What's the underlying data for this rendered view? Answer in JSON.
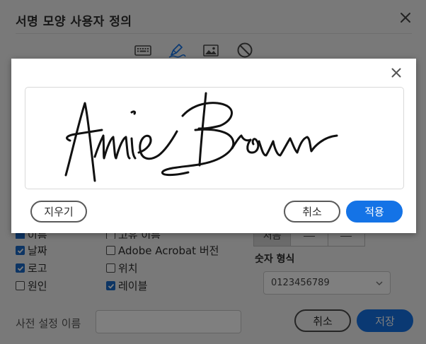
{
  "background_dialog": {
    "title": "서명 모양 사용자 정의",
    "mode_icons": [
      "keyboard-icon",
      "pen-draw-icon",
      "image-icon",
      "none-icon"
    ],
    "active_mode": "pen-draw-icon",
    "checkboxes": [
      {
        "label": "날짜",
        "checked": true
      },
      {
        "label": "로고",
        "checked": true
      },
      {
        "label": "원인",
        "checked": false
      },
      {
        "label": "Adobe Acrobat 버전",
        "checked": false
      },
      {
        "label": "위치",
        "checked": false
      },
      {
        "label": "레이블",
        "checked": true
      }
    ],
    "alignment": {
      "first_label": "처음"
    },
    "number_format": {
      "label": "숫자 형식",
      "selected": "0123456789"
    },
    "preset": {
      "label": "사전 설정 이름",
      "value": ""
    },
    "buttons": {
      "cancel": "취소",
      "save": "저장"
    }
  },
  "modal": {
    "signature_text": "Annie Brown",
    "buttons": {
      "clear": "지우기",
      "cancel": "취소",
      "apply": "적용"
    }
  },
  "colors": {
    "accent": "#1473e6",
    "checkbox_checked": "#1b6ac9",
    "overlay": "rgba(0,0,0,0.5)"
  }
}
